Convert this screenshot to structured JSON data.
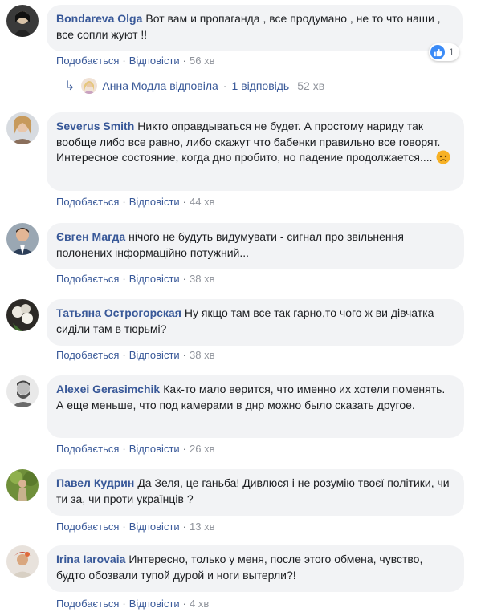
{
  "actions": {
    "like": "Подобається",
    "reply": "Відповісти",
    "dot": "·"
  },
  "comments": [
    {
      "author": "Bondareva Olga",
      "text": "Вот вам и пропаганда , все продумано , не то что наши , все сопли жуют !!",
      "time": "56 хв",
      "reactions": {
        "icon": "like-icon",
        "count": "1"
      },
      "replies": {
        "author_summary": "Анна Модла відповіла",
        "count_label": "1 відповідь",
        "time": "52 хв"
      }
    },
    {
      "author": "Severus Smith",
      "text": "Никто оправдываться не будет. А простому нариду так вообще либо все равно, либо скажут что бабенки правильно все говорят. Интересное состояние, когда дно пробито, но падение продолжается....",
      "emoji": "sad-face-icon",
      "time": "44 хв"
    },
    {
      "author": "Євген Магда",
      "text": "нічого не будуть видумувати - сигнал про звільнення полонених інформаційно потужний...",
      "time": "38 хв"
    },
    {
      "author": "Татьяна Острогорская",
      "text": "Ну якщо там все так гарно,то чого ж ви дівчатка сиділи там в тюрьмі?",
      "time": "38 хв"
    },
    {
      "author": "Alexei Gerasimchik",
      "text": "Как-то мало верится, что именно их хотели поменять. А еще меньше, что под камерами в днр можно было сказать другое.",
      "time": "26 хв"
    },
    {
      "author": "Павел Кудрин",
      "text": "Да Зеля, це ганьба! Дивлюся і не розумію твоєї політики, чи ти за, чи проти українців ?",
      "time": "13 хв"
    },
    {
      "author": "Irina Iarovaia",
      "text": "Интересно, только у меня, после этого обмена, чувство, будто обозвали тупой дурой и ноги вытерли?!",
      "time": "4 хв"
    }
  ],
  "colors": {
    "link": "#385898",
    "bubble": "#f2f3f5",
    "meta": "#90949c",
    "like_blue": "#3b8bf7"
  }
}
